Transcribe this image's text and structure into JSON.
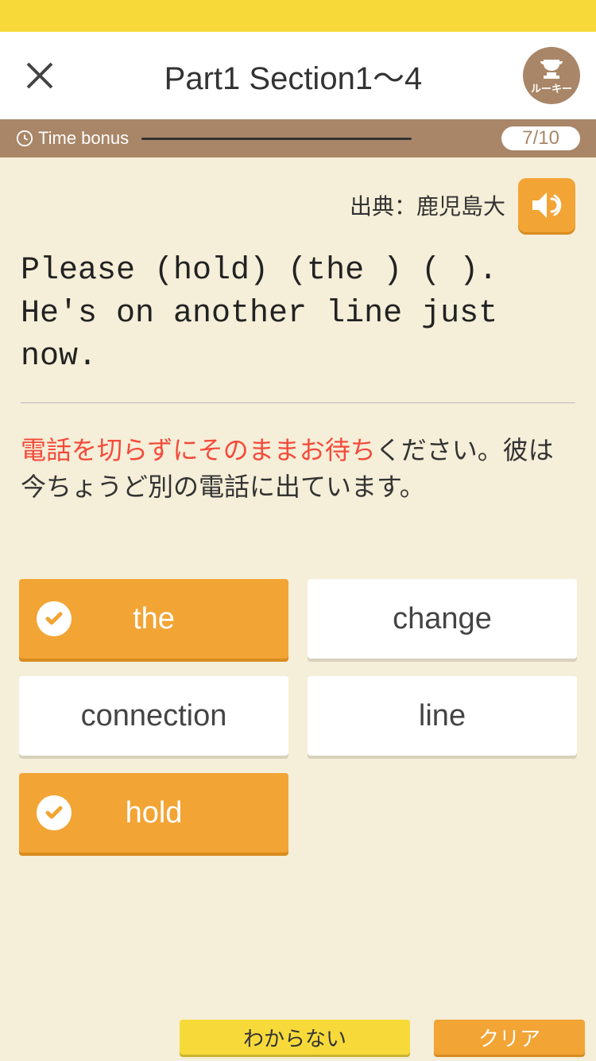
{
  "header": {
    "title": "Part1 Section1～4",
    "trophy_label": "ルーキー"
  },
  "info_bar": {
    "time_bonus_label": "Time bonus",
    "progress": "7/10"
  },
  "source": {
    "label": "出典：鹿児島大"
  },
  "question": {
    "text": "Please (hold) (the ) (     ). He's on another line just now."
  },
  "translation": {
    "highlight": "電話を切らずにそのままお待ち",
    "rest": "ください。彼は今ちょうど別の電話に出ています。"
  },
  "choices": [
    {
      "label": "the",
      "selected": true
    },
    {
      "label": "change",
      "selected": false
    },
    {
      "label": "connection",
      "selected": false
    },
    {
      "label": "line",
      "selected": false
    },
    {
      "label": "hold",
      "selected": true
    }
  ],
  "buttons": {
    "idk": "わからない",
    "clear": "クリア"
  }
}
